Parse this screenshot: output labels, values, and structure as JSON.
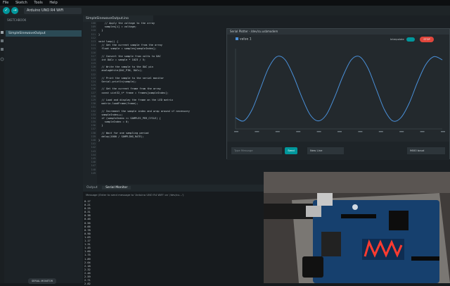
{
  "menu": [
    "File",
    "Sketch",
    "Tools",
    "Help"
  ],
  "toolbar": {
    "verify": "✓",
    "upload": "→",
    "debug": "▶",
    "board": "Arduino UNO R4 WiFi"
  },
  "sidebar": {
    "title": "SKETCHBOOK",
    "file": "SimpleSinewaveOutput"
  },
  "editor": {
    "tab": "SimpleSinewaveOutput.ino",
    "line_numbers": [
      "108",
      "109",
      "110",
      "111",
      "112",
      "113",
      "114",
      "115",
      "116",
      "117",
      "118",
      "119",
      "120",
      "121",
      "122",
      "123",
      "124",
      "125",
      "126",
      "127",
      "128",
      "129",
      "130",
      "131",
      "132",
      "133",
      "134",
      "135",
      "136",
      "137",
      "138",
      "139",
      "140",
      "141",
      "142",
      "143",
      "144",
      "145",
      "146",
      "147",
      "148",
      "149"
    ],
    "lines": [
      "    // Apply the voltage to the array",
      "    samples[i] = voltage;",
      "  }",
      "}",
      "",
      "void loop() {",
      "  // Get the current sample from the array",
      "  float sample = samples[sampleIndex];",
      "",
      "  // Convert the sample from volts to DAC",
      "  int DACv = sample * 1023 / 5;",
      "",
      "  // Write the sample to the DAC pin",
      "  analogWrite(DAC_PIN, DACv);",
      "",
      "  // Print the sample to the serial monitor",
      "  Serial.println(sample);",
      "",
      "  // Get the current frame from the array",
      "  const uint32_t* frame = frames[sampleIndex];",
      "",
      "  // Load and display the frame on the LED matrix",
      "  matrix.loadFrame(frame);",
      "",
      "  // Increment the sample index and wrap around if necessary",
      "  sampleIndex++;",
      "  if (sampleIndex >= SAMPLES_PER_CYCLE) {",
      "    sampleIndex = 0;",
      "  }",
      "",
      "  // Wait for one sampling period",
      "  delay(1000 / SAMPLING_RATE);",
      "}",
      "",
      "",
      "",
      "",
      "",
      "",
      "",
      "",
      ""
    ]
  },
  "plotter": {
    "window_title": "Serial Plotter - /dev/cu.usbmodem",
    "legend": "value 1",
    "interpolate_label": "Interpolate",
    "stop_label": "STOP",
    "message_placeholder": "Type Message",
    "send_label": "Send",
    "line_ending": "New Line",
    "baud": "9600 baud",
    "line_color": "#4a90d9"
  },
  "chart_data": {
    "type": "line",
    "title": "",
    "xlabel": "",
    "ylabel": "",
    "ylim": [
      0,
      5
    ],
    "xlim": [
      0,
      50
    ],
    "grid": false,
    "legend_placement": "top-left",
    "series": [
      {
        "name": "value 1",
        "x": [
          0,
          2,
          4,
          6,
          8,
          10,
          12,
          14,
          16,
          18,
          20,
          22,
          24,
          26,
          28,
          30,
          32,
          34,
          36,
          38,
          40,
          42,
          44,
          46,
          48,
          50
        ],
        "values": [
          0.7,
          0.5,
          1.2,
          2.5,
          3.8,
          4.5,
          4.3,
          3.3,
          2.0,
          0.9,
          0.5,
          0.9,
          2.0,
          3.3,
          4.3,
          4.5,
          3.8,
          2.5,
          1.2,
          0.5,
          0.7,
          1.6,
          2.9,
          4.0,
          4.5,
          4.3
        ]
      }
    ]
  },
  "bottom": {
    "tabs": [
      "Output",
      "Serial Monitor"
    ],
    "active_tab": 1,
    "message_hint": "Message (Enter to send message to 'Arduino UNO R4 WiFi' on '/dev/cu...')",
    "serial_values": [
      "0.17",
      "0.21",
      "0.25",
      "0.31",
      "0.38",
      "0.46",
      "0.56",
      "0.66",
      "0.78",
      "0.90",
      "1.03",
      "1.17",
      "1.31",
      "1.45",
      "1.60",
      "1.75",
      "1.89",
      "2.04",
      "2.18",
      "2.32",
      "2.46",
      "2.59",
      "2.71",
      "2.82"
    ]
  },
  "status": {
    "button": "SERIAL MONITOR"
  }
}
